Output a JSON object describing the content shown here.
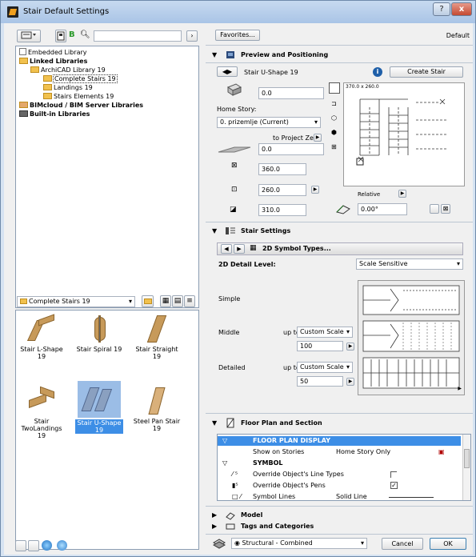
{
  "window": {
    "title": "Stair Default Settings",
    "help_btn": "?",
    "close_btn": "x"
  },
  "left": {
    "search_placeholder": "",
    "tree": [
      {
        "label": "Embedded Library",
        "indent": 0,
        "bold": false,
        "selected": false
      },
      {
        "label": "Linked Libraries",
        "indent": 0,
        "bold": true,
        "selected": false
      },
      {
        "label": "ArchiCAD Library 19",
        "indent": 1,
        "bold": false,
        "selected": false
      },
      {
        "label": "Complete Stairs 19",
        "indent": 2,
        "bold": false,
        "selected": true
      },
      {
        "label": "Landings 19",
        "indent": 2,
        "bold": false,
        "selected": false
      },
      {
        "label": "Stairs Elements 19",
        "indent": 2,
        "bold": false,
        "selected": false
      },
      {
        "label": "BIMcloud / BIM Server Libraries",
        "indent": 0,
        "bold": true,
        "selected": false
      },
      {
        "label": "Built-in Libraries",
        "indent": 0,
        "bold": true,
        "selected": false
      }
    ],
    "folder_select": "Complete Stairs 19",
    "items": [
      {
        "label": "Stair L-Shape 19"
      },
      {
        "label": "Stair Spiral 19"
      },
      {
        "label": "Stair Straight 19"
      },
      {
        "label": "Stair TwoLandings 19"
      },
      {
        "label": "Stair U-Shape 19",
        "selected": true
      },
      {
        "label": "Steel Pan Stair 19"
      }
    ]
  },
  "right": {
    "favorites_btn": "Favorites...",
    "default_label": "Default",
    "preview_section": "Preview and Positioning",
    "object_name": "Stair U-Shape 19",
    "create_stair_btn": "Create Stair",
    "plan_size": "370.0 x 260.0",
    "offset_value": "0.0",
    "home_story_label": "Home Story:",
    "home_story_value": "0. prizemlje (Current)",
    "to_project_zero": "to Project Zero",
    "elevation_value": "0.0",
    "width_value": "360.0",
    "depth_value": "260.0",
    "height_value": "310.0",
    "relative_label": "Relative",
    "angle_value": "0.00°",
    "stair_settings_section": "Stair Settings",
    "page_tab": "2D Symbol Types...",
    "detail_level_label": "2D Detail Level:",
    "detail_level_value": "Scale Sensitive",
    "simple_label": "Simple",
    "middle_label": "Middle",
    "middle_upto": "up to",
    "middle_scale": "Custom Scale",
    "middle_value": "100",
    "detailed_label": "Detailed",
    "detailed_upto": "up to",
    "detailed_scale": "Custom Scale",
    "detailed_value": "50",
    "floorplan_section": "Floor Plan and Section",
    "table": {
      "header": "FLOOR PLAN DISPLAY",
      "show_on_stories": "Show on Stories",
      "show_value": "Home Story Only",
      "symbol_group": "SYMBOL",
      "override_line_types": "Override Object's Line Types",
      "override_pens": "Override Object's Pens",
      "symbol_lines": "Symbol Lines",
      "symbol_lines_value": "Solid Line"
    },
    "model_section": "Model",
    "tags_section": "Tags and Categories",
    "structural_value": "Structural - Combined",
    "cancel_btn": "Cancel",
    "ok_btn": "OK"
  },
  "colors": {
    "accent": "#3d8ee6",
    "title_bg": "#b7cfeb",
    "wood": "#c79a5a"
  }
}
